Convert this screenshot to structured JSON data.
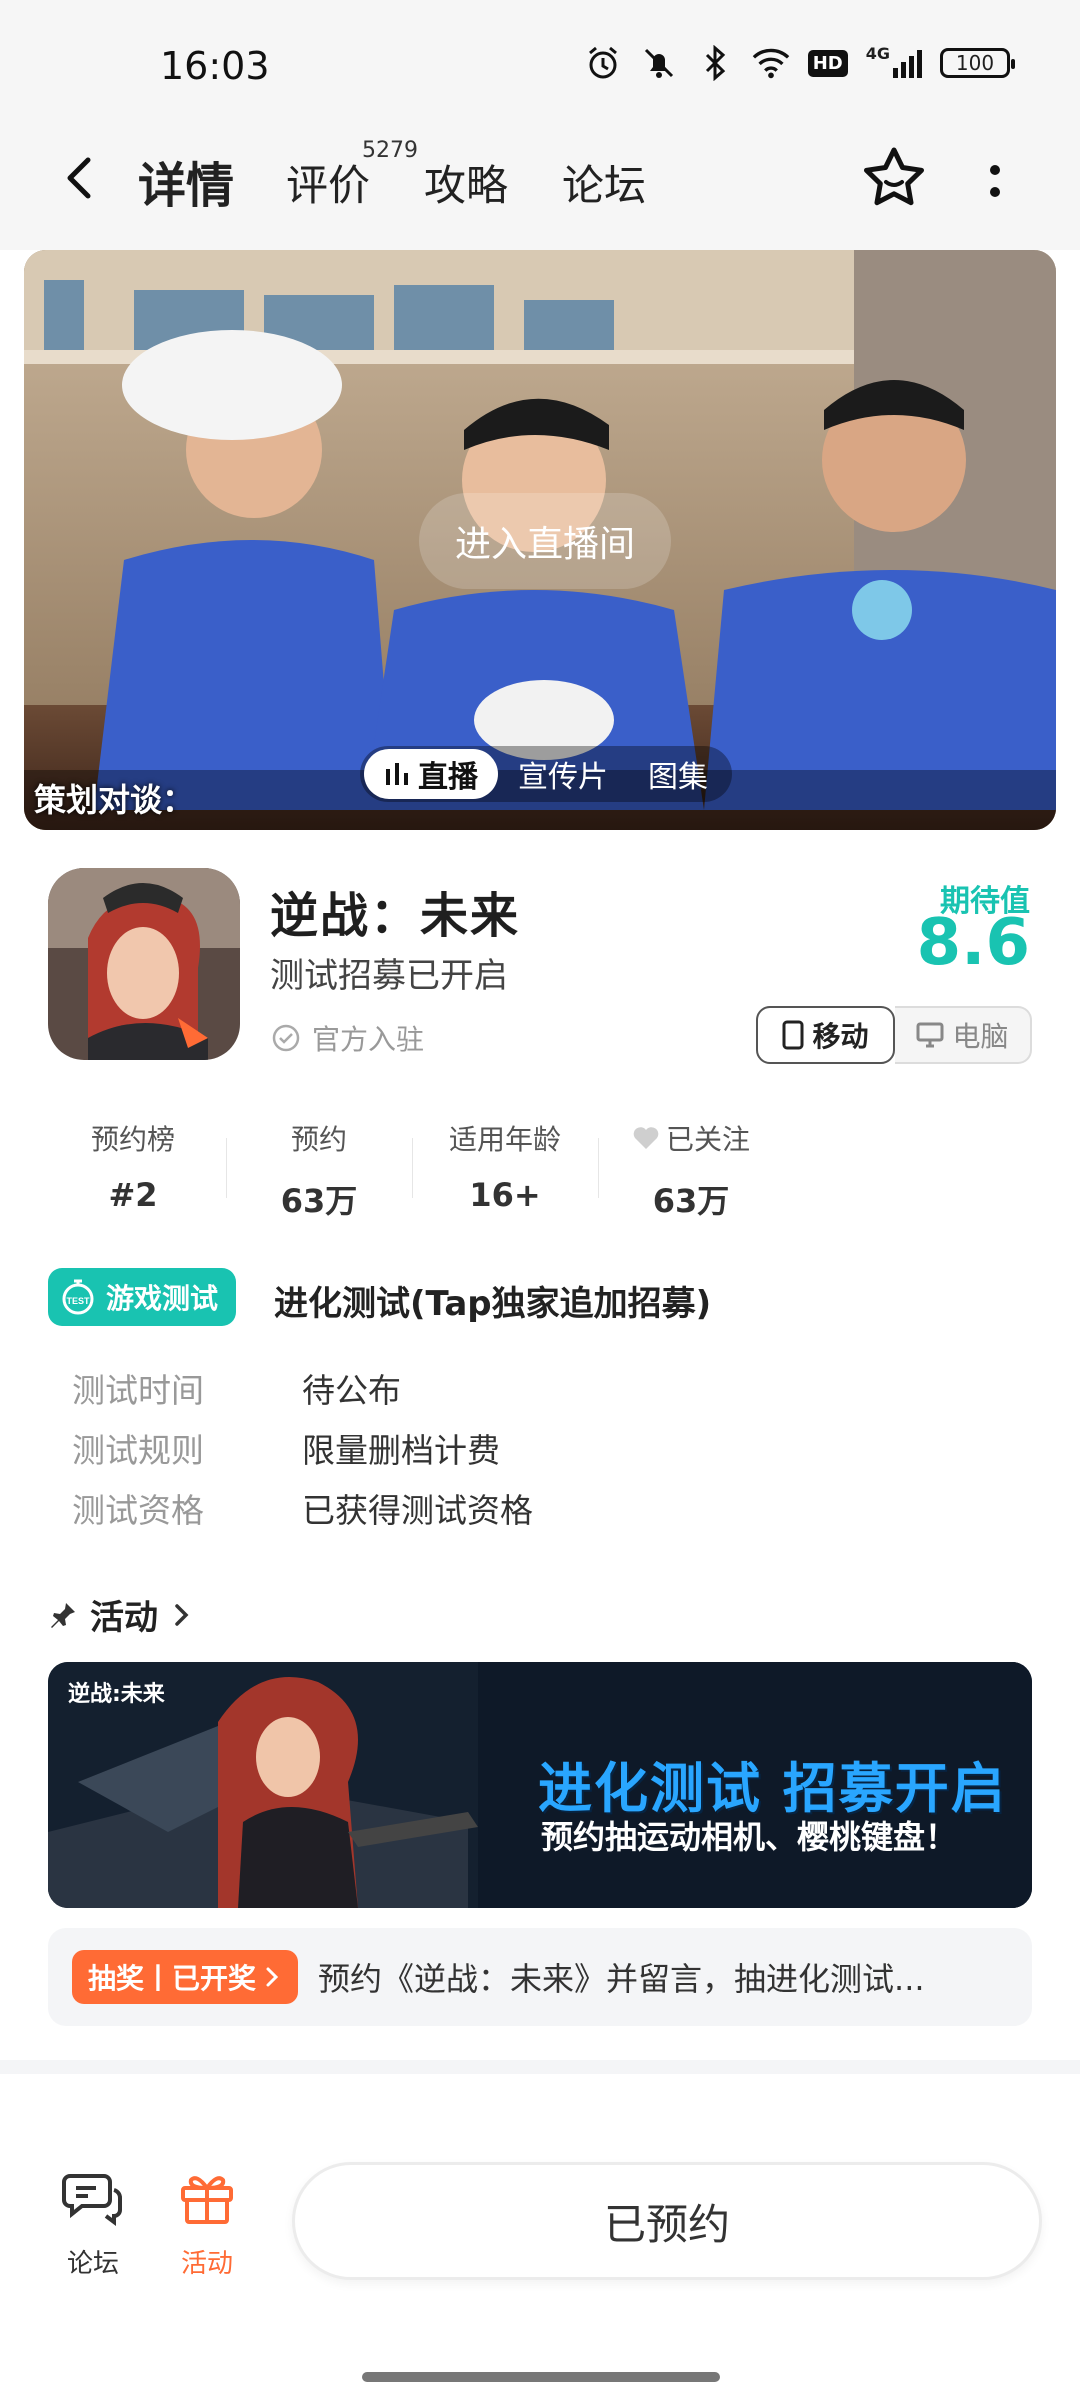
{
  "status": {
    "time": "16:03",
    "battery": "100",
    "hd": "HD",
    "network": "4G"
  },
  "nav": {
    "tabs": [
      {
        "label": "详情"
      },
      {
        "label": "评价"
      },
      {
        "label": "攻略"
      },
      {
        "label": "论坛"
      }
    ],
    "review_count": "5279"
  },
  "media": {
    "live_button": "进入直播间",
    "tabs": [
      {
        "label": "直播"
      },
      {
        "label": "宣传片"
      },
      {
        "label": "图集"
      }
    ],
    "caption": "策划对谈："
  },
  "game": {
    "title": "逆战：未来",
    "subtitle": "测试招募已开启",
    "official": "官方入驻",
    "expect_label": "期待值",
    "expect_value": "8.6",
    "platforms": [
      {
        "label": "移动"
      },
      {
        "label": "电脑"
      }
    ]
  },
  "stats": [
    {
      "label": "预约榜",
      "value": "#2"
    },
    {
      "label": "预约",
      "value": "63万"
    },
    {
      "label": "适用年龄",
      "value": "16+"
    },
    {
      "label": "已关注",
      "value": "63万"
    }
  ],
  "test": {
    "badge": "游戏测试",
    "title": "进化测试(Tap独家追加招募)",
    "rows": [
      {
        "k": "测试时间",
        "v": "待公布"
      },
      {
        "k": "测试规则",
        "v": "限量删档计费"
      },
      {
        "k": "测试资格",
        "v": "已获得测试资格"
      }
    ]
  },
  "activity": {
    "header": "活动",
    "banner_logo": "逆战:未来",
    "banner_title": "进化测试 招募开启",
    "banner_subtitle": "预约抽运动相机、樱桃键盘！",
    "lottery_tag": "抽奖丨已开奖",
    "lottery_text": "预约《逆战：未来》并留言，抽进化测试..."
  },
  "bottom": {
    "forum": "论坛",
    "activity": "活动",
    "reserve": "已预约"
  },
  "colors": {
    "accent": "#19c3b1",
    "orange": "#ff6b35"
  }
}
